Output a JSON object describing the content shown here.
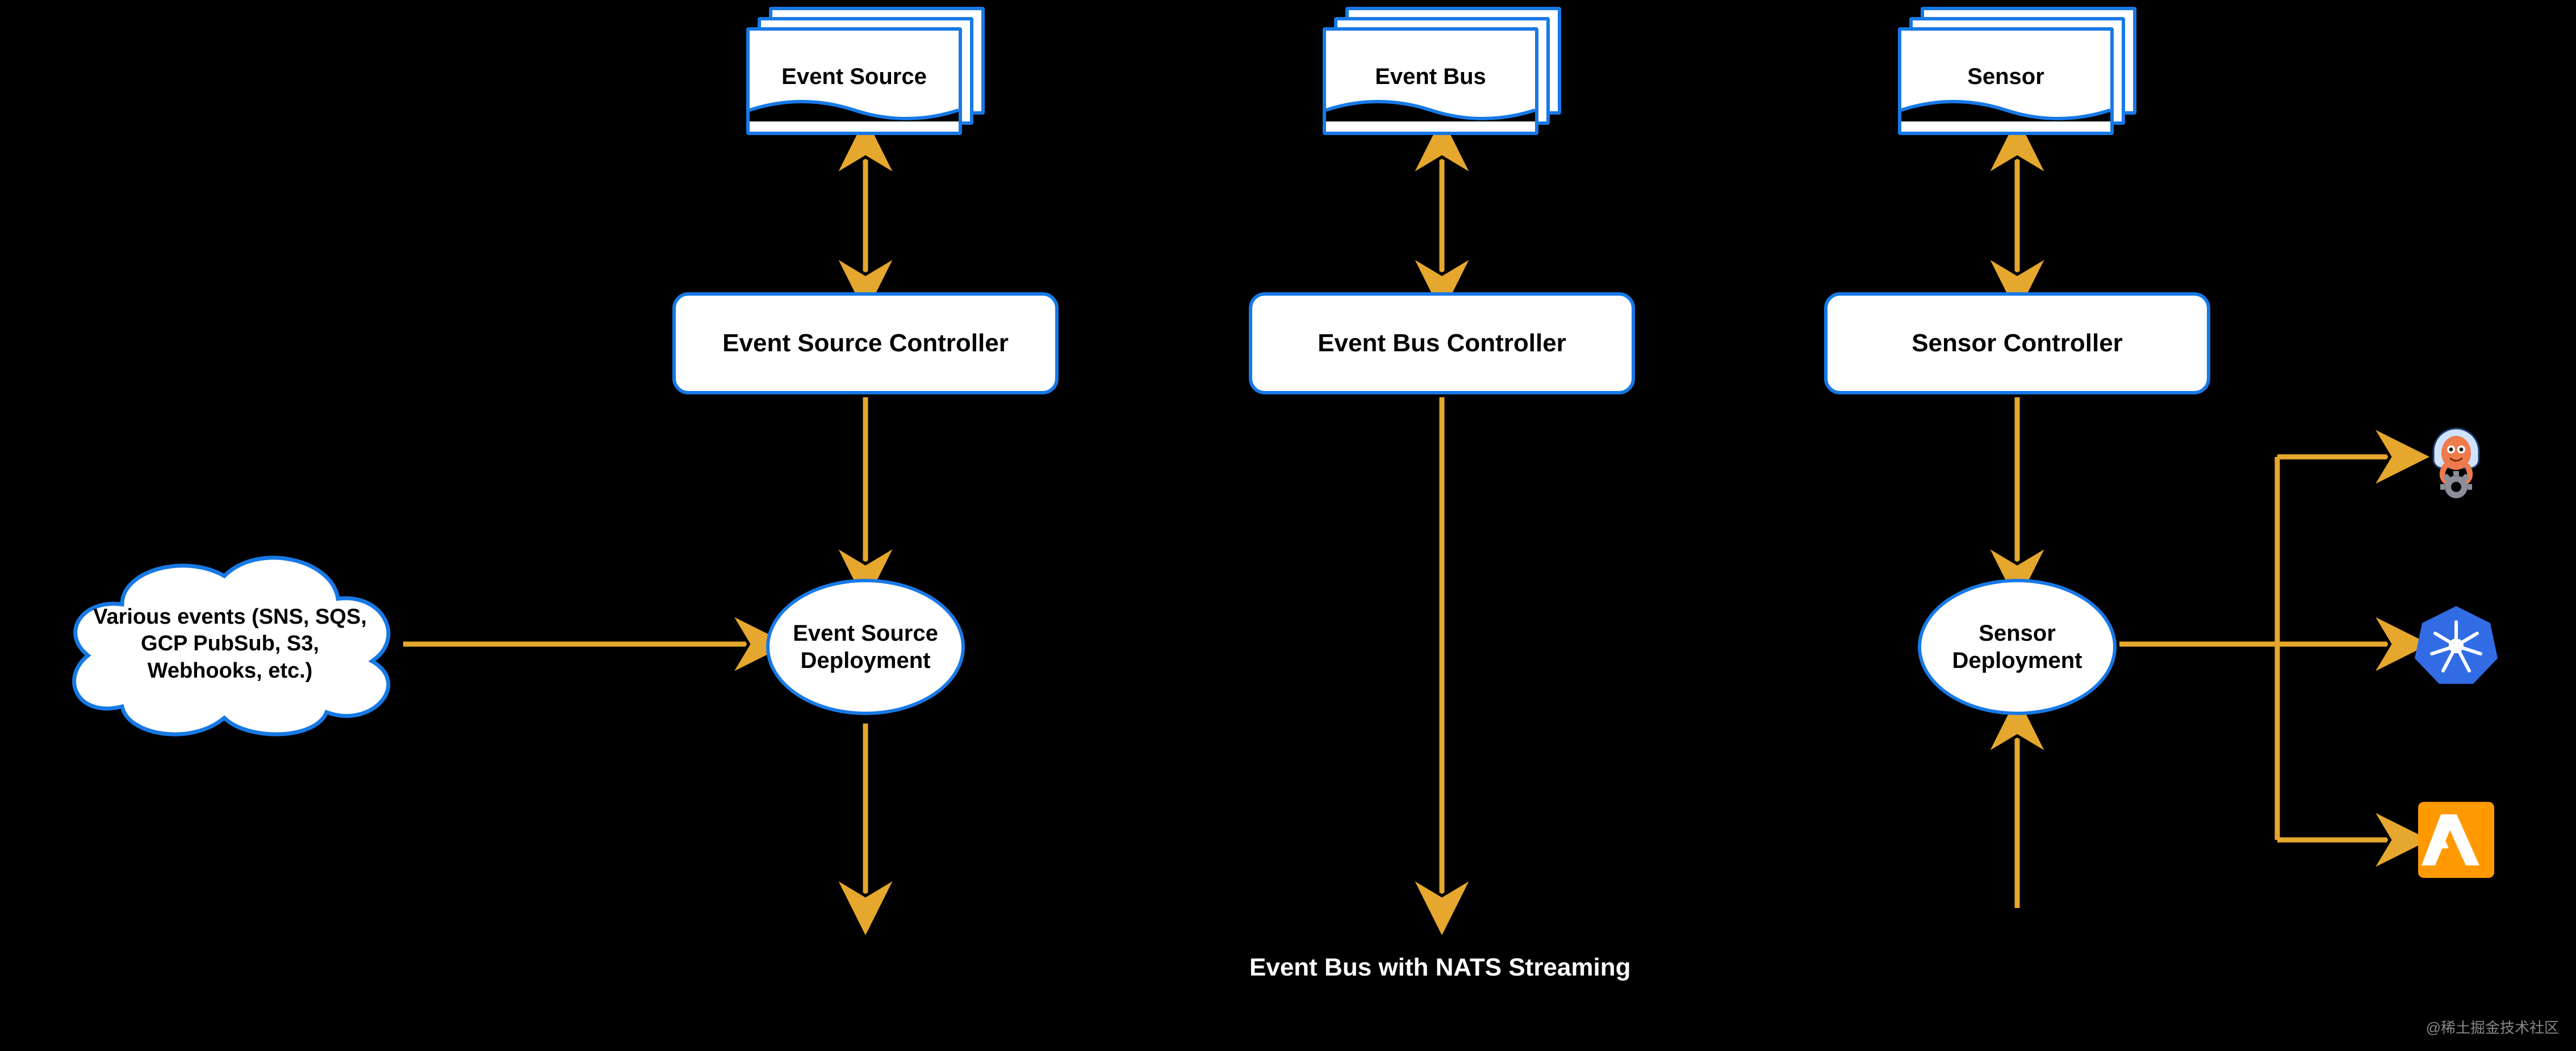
{
  "diagram": {
    "sources": {
      "event_source": {
        "label": "Event Source"
      },
      "event_bus": {
        "label": "Event Bus"
      },
      "sensor": {
        "label": "Sensor"
      }
    },
    "controllers": {
      "event_source": {
        "label": "Event Source Controller"
      },
      "event_bus": {
        "label": "Event Bus Controller"
      },
      "sensor": {
        "label": "Sensor Controller"
      }
    },
    "deployments": {
      "event_source": {
        "label": "Event Source\nDeployment"
      },
      "sensor": {
        "label": "Sensor\nDeployment"
      }
    },
    "inputs": {
      "cloud": {
        "label": "Various events (SNS, SQS, GCP PubSub, S3, Webhooks, etc.)"
      }
    },
    "footer": {
      "label": "Event Bus with NATS Streaming"
    },
    "targets": {
      "argo": {
        "name": "argo-workflows-icon"
      },
      "kubernetes": {
        "name": "kubernetes-icon"
      },
      "lambda": {
        "name": "aws-lambda-icon"
      }
    },
    "watermark": "@稀土掘金技术社区",
    "colors": {
      "border": "#1779e6",
      "arrow": "#e5a72d",
      "lambda": "#ff9900",
      "k8s": "#326ce5",
      "argo_body": "#ef7b4d"
    }
  }
}
